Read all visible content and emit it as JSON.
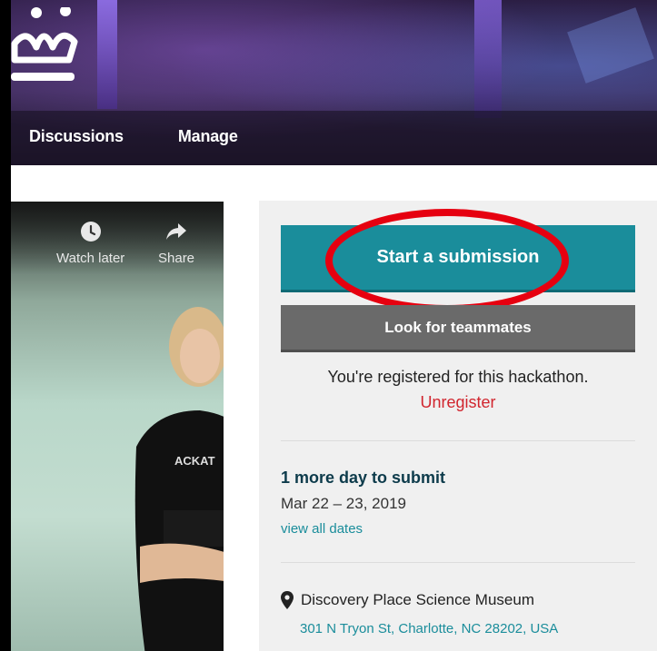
{
  "nav": {
    "items": [
      {
        "label": "Discussions"
      },
      {
        "label": "Manage"
      }
    ]
  },
  "video": {
    "watch_later": "Watch later",
    "share": "Share",
    "shirt_text": "ACKAT"
  },
  "sidebar": {
    "primary_button": "Start a submission",
    "secondary_button": "Look for teammates",
    "registered_text": "You're registered for this hackathon.",
    "unregister": "Unregister",
    "deadline": "1 more day to submit",
    "dates": "Mar 22 – 23, 2019",
    "view_all_dates": "view all dates",
    "venue": "Discovery Place Science Museum",
    "address": "301 N Tryon St, Charlotte, NC 28202, USA"
  },
  "colors": {
    "primary": "#1a8d9b",
    "secondary": "#6a6a6a",
    "highlight_circle": "#e60010",
    "unregister": "#d1252e"
  },
  "icons": {
    "logo": "crown-logo-icon",
    "watch_later": "clock-icon",
    "share": "share-arrow-icon",
    "location": "map-pin-icon"
  }
}
